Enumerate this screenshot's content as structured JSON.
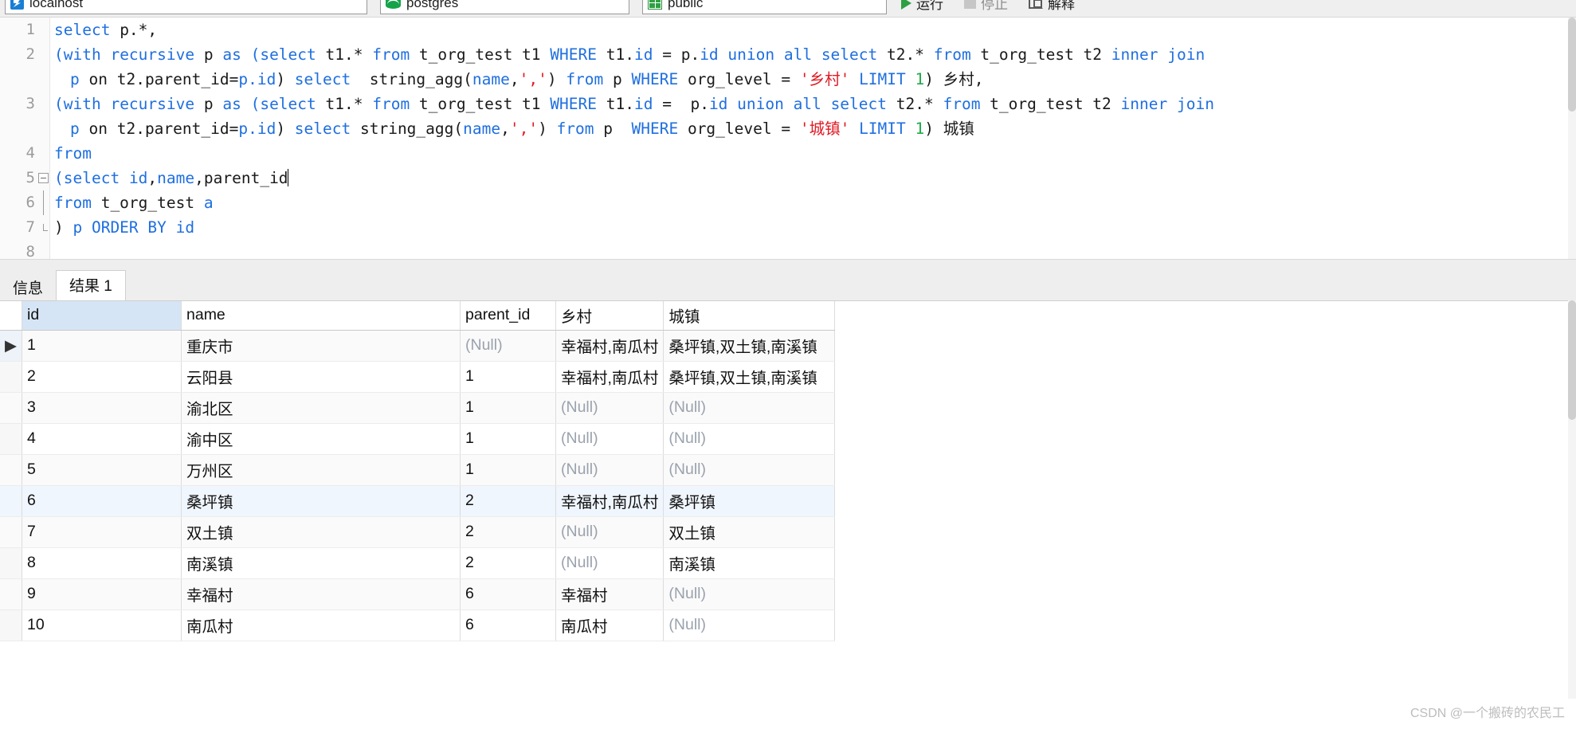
{
  "toolbar": {
    "connection": "localhost",
    "database": "postgres",
    "schema": "public",
    "run_label": "运行",
    "stop_label": "停止",
    "explain_label": "解释",
    "icons": {
      "server": "server-icon",
      "database": "database-icon",
      "schema": "schema-grid-icon",
      "run": "play-icon",
      "stop": "stop-icon",
      "explain": "explain-icon"
    }
  },
  "editor": {
    "lines": [
      {
        "num": "1",
        "fold": "none",
        "indent": false,
        "segments": [
          {
            "t": "select ",
            "c": "kw"
          },
          {
            "t": "p.*,",
            "c": "pln"
          }
        ]
      },
      {
        "num": "2",
        "fold": "none",
        "indent": false,
        "segments": [
          {
            "t": "(",
            "c": "kw"
          },
          {
            "t": "with recursive ",
            "c": "kw"
          },
          {
            "t": "p ",
            "c": "pln"
          },
          {
            "t": "as ",
            "c": "kw"
          },
          {
            "t": "(",
            "c": "kw"
          },
          {
            "t": "select ",
            "c": "kw"
          },
          {
            "t": "t1.* ",
            "c": "pln"
          },
          {
            "t": "from ",
            "c": "kw"
          },
          {
            "t": "t_org_test t1 ",
            "c": "pln"
          },
          {
            "t": "WHERE ",
            "c": "kw"
          },
          {
            "t": "t1.",
            "c": "pln"
          },
          {
            "t": "id ",
            "c": "kw"
          },
          {
            "t": "= ",
            "c": "pln"
          },
          {
            "t": "p.",
            "c": "pln"
          },
          {
            "t": "id ",
            "c": "kw"
          },
          {
            "t": "union all select ",
            "c": "kw"
          },
          {
            "t": "t2.* ",
            "c": "pln"
          },
          {
            "t": "from ",
            "c": "kw"
          },
          {
            "t": "t_org_test t2 ",
            "c": "pln"
          },
          {
            "t": "inner join",
            "c": "kw"
          }
        ]
      },
      {
        "num": "",
        "fold": "none",
        "indent": true,
        "segments": [
          {
            "t": "p ",
            "c": "kw"
          },
          {
            "t": "on ",
            "c": "pln"
          },
          {
            "t": "t2.parent_id=",
            "c": "pln"
          },
          {
            "t": "p.",
            "c": "kw"
          },
          {
            "t": "id",
            "c": "kw"
          },
          {
            "t": ") ",
            "c": "pln"
          },
          {
            "t": "select ",
            "c": "kw"
          },
          {
            "t": " string_agg(",
            "c": "pln"
          },
          {
            "t": "name",
            "c": "kw"
          },
          {
            "t": ",",
            "c": "pln"
          },
          {
            "t": "','",
            "c": "str"
          },
          {
            "t": ") ",
            "c": "pln"
          },
          {
            "t": "from ",
            "c": "kw"
          },
          {
            "t": "p ",
            "c": "pln"
          },
          {
            "t": "WHERE ",
            "c": "kw"
          },
          {
            "t": "org_level = ",
            "c": "pln"
          },
          {
            "t": "'乡村'",
            "c": "str"
          },
          {
            "t": " LIMIT ",
            "c": "kw"
          },
          {
            "t": "1",
            "c": "num"
          },
          {
            "t": ") 乡村,",
            "c": "pln"
          }
        ]
      },
      {
        "num": "3",
        "fold": "none",
        "indent": false,
        "segments": [
          {
            "t": "(",
            "c": "kw"
          },
          {
            "t": "with recursive ",
            "c": "kw"
          },
          {
            "t": "p ",
            "c": "pln"
          },
          {
            "t": "as ",
            "c": "kw"
          },
          {
            "t": "(",
            "c": "kw"
          },
          {
            "t": "select ",
            "c": "kw"
          },
          {
            "t": "t1.* ",
            "c": "pln"
          },
          {
            "t": "from ",
            "c": "kw"
          },
          {
            "t": "t_org_test t1 ",
            "c": "pln"
          },
          {
            "t": "WHERE ",
            "c": "kw"
          },
          {
            "t": "t1.",
            "c": "pln"
          },
          {
            "t": "id ",
            "c": "kw"
          },
          {
            "t": "=  ",
            "c": "pln"
          },
          {
            "t": "p.",
            "c": "pln"
          },
          {
            "t": "id ",
            "c": "kw"
          },
          {
            "t": "union all select ",
            "c": "kw"
          },
          {
            "t": "t2.* ",
            "c": "pln"
          },
          {
            "t": "from ",
            "c": "kw"
          },
          {
            "t": "t_org_test t2 ",
            "c": "pln"
          },
          {
            "t": "inner join",
            "c": "kw"
          }
        ]
      },
      {
        "num": "",
        "fold": "none",
        "indent": true,
        "segments": [
          {
            "t": "p ",
            "c": "kw"
          },
          {
            "t": "on ",
            "c": "pln"
          },
          {
            "t": "t2.parent_id=",
            "c": "pln"
          },
          {
            "t": "p.",
            "c": "kw"
          },
          {
            "t": "id",
            "c": "kw"
          },
          {
            "t": ") ",
            "c": "pln"
          },
          {
            "t": "select ",
            "c": "kw"
          },
          {
            "t": "string_agg(",
            "c": "pln"
          },
          {
            "t": "name",
            "c": "kw"
          },
          {
            "t": ",",
            "c": "pln"
          },
          {
            "t": "','",
            "c": "str"
          },
          {
            "t": ") ",
            "c": "pln"
          },
          {
            "t": "from ",
            "c": "kw"
          },
          {
            "t": "p  ",
            "c": "pln"
          },
          {
            "t": "WHERE ",
            "c": "kw"
          },
          {
            "t": "org_level = ",
            "c": "pln"
          },
          {
            "t": "'城镇'",
            "c": "str"
          },
          {
            "t": " LIMIT ",
            "c": "kw"
          },
          {
            "t": "1",
            "c": "num"
          },
          {
            "t": ") 城镇",
            "c": "pln"
          }
        ]
      },
      {
        "num": "4",
        "fold": "none",
        "indent": false,
        "segments": [
          {
            "t": "from",
            "c": "kw"
          }
        ]
      },
      {
        "num": "5",
        "fold": "box",
        "indent": false,
        "segments": [
          {
            "t": "(",
            "c": "kw"
          },
          {
            "t": "select ",
            "c": "kw"
          },
          {
            "t": "id",
            "c": "kw"
          },
          {
            "t": ",",
            "c": "pln"
          },
          {
            "t": "name",
            "c": "kw"
          },
          {
            "t": ",",
            "c": "pln"
          },
          {
            "t": "parent_id",
            "c": "pln"
          },
          {
            "t": "|CARET|",
            "c": "caret"
          }
        ]
      },
      {
        "num": "6",
        "fold": "line",
        "indent": false,
        "segments": [
          {
            "t": "from ",
            "c": "kw"
          },
          {
            "t": "t_org_test ",
            "c": "pln"
          },
          {
            "t": "a",
            "c": "kw"
          }
        ]
      },
      {
        "num": "7",
        "fold": "end",
        "indent": false,
        "segments": [
          {
            "t": ") ",
            "c": "pln"
          },
          {
            "t": "p ORDER BY ",
            "c": "kw"
          },
          {
            "t": "id",
            "c": "kw"
          }
        ]
      },
      {
        "num": "8",
        "fold": "none",
        "indent": false,
        "segments": []
      }
    ]
  },
  "results": {
    "tabs": [
      {
        "label": "信息",
        "active": false
      },
      {
        "label": "结果 1",
        "active": true
      }
    ],
    "columns": [
      "id",
      "name",
      "parent_id",
      "乡村",
      "城镇"
    ],
    "null_text": "(Null)",
    "rows": [
      {
        "id": "1",
        "name": "重庆市",
        "parent_id": "(Null)",
        "xiangcun": "幸福村,南瓜村",
        "chengzhen": "桑坪镇,双土镇,南溪镇"
      },
      {
        "id": "2",
        "name": "云阳县",
        "parent_id": "1",
        "xiangcun": "幸福村,南瓜村",
        "chengzhen": "桑坪镇,双土镇,南溪镇"
      },
      {
        "id": "3",
        "name": "渝北区",
        "parent_id": "1",
        "xiangcun": "(Null)",
        "chengzhen": "(Null)"
      },
      {
        "id": "4",
        "name": "渝中区",
        "parent_id": "1",
        "xiangcun": "(Null)",
        "chengzhen": "(Null)"
      },
      {
        "id": "5",
        "name": "万州区",
        "parent_id": "1",
        "xiangcun": "(Null)",
        "chengzhen": "(Null)"
      },
      {
        "id": "6",
        "name": "桑坪镇",
        "parent_id": "2",
        "xiangcun": "幸福村,南瓜村",
        "chengzhen": "桑坪镇"
      },
      {
        "id": "7",
        "name": "双土镇",
        "parent_id": "2",
        "xiangcun": "(Null)",
        "chengzhen": "双土镇"
      },
      {
        "id": "8",
        "name": "南溪镇",
        "parent_id": "2",
        "xiangcun": "(Null)",
        "chengzhen": "南溪镇"
      },
      {
        "id": "9",
        "name": "幸福村",
        "parent_id": "6",
        "xiangcun": "幸福村",
        "chengzhen": "(Null)"
      },
      {
        "id": "10",
        "name": "南瓜村",
        "parent_id": "6",
        "xiangcun": "南瓜村",
        "chengzhen": "(Null)"
      }
    ]
  },
  "watermark": "CSDN @一个搬砖的农民工"
}
